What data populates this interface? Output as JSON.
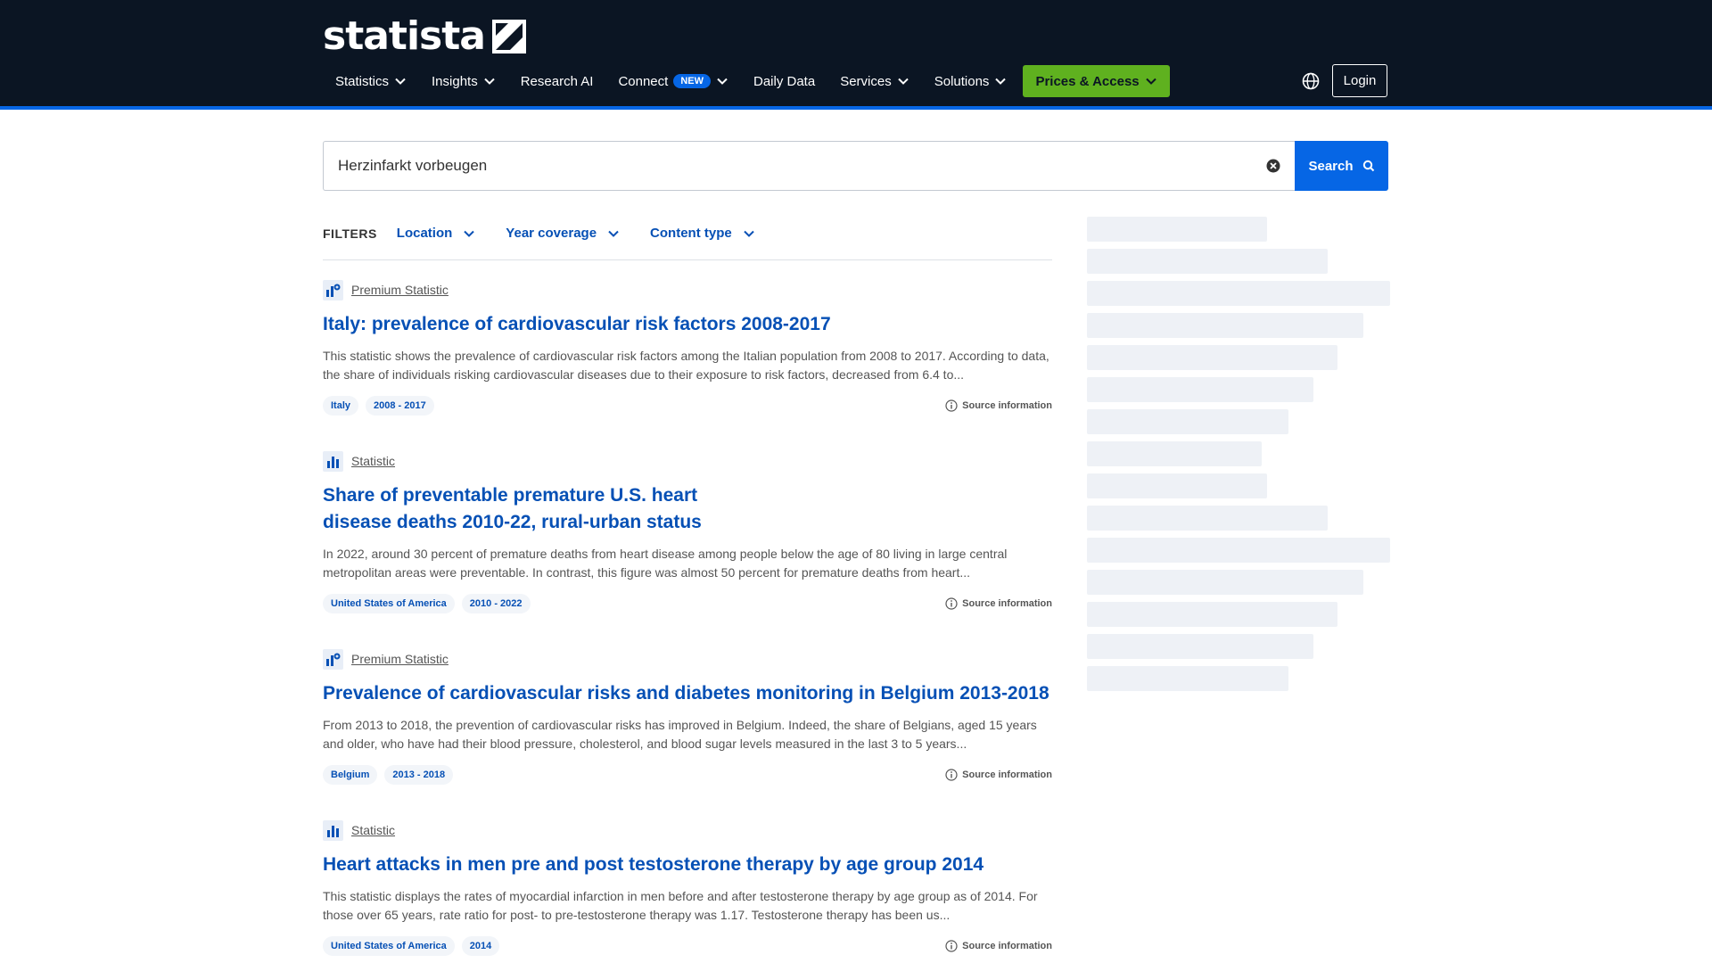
{
  "header": {
    "logo": "statista",
    "nav": [
      {
        "label": "Statistics",
        "chevron": true
      },
      {
        "label": "Insights",
        "chevron": true
      },
      {
        "label": "Research AI",
        "chevron": false
      },
      {
        "label": "Connect",
        "chevron": true,
        "badge": "NEW"
      },
      {
        "label": "Daily Data",
        "chevron": false
      },
      {
        "label": "Services",
        "chevron": true
      },
      {
        "label": "Solutions",
        "chevron": true
      }
    ],
    "prices_label": "Prices & Access",
    "login_label": "Login"
  },
  "search": {
    "value": "Herzinfarkt vorbeugen",
    "button_label": "Search"
  },
  "filters": {
    "label": "FILTERS",
    "items": [
      "Location",
      "Year coverage",
      "Content type"
    ]
  },
  "results": [
    {
      "type": "Premium Statistic",
      "premium": true,
      "title": "Italy: prevalence of cardiovascular risk factors 2008-2017",
      "desc": "This statistic shows the prevalence of cardiovascular risk factors among the Italian population from 2008 to 2017. According to data, the share of individuals risking cardiovascular diseases due to their exposure to risk factors, decreased from 6.4 to...",
      "tags": [
        "Italy",
        "2008 - 2017"
      ],
      "source": "Source information"
    },
    {
      "type": "Statistic",
      "premium": false,
      "title": "Share of preventable premature U.S. heart disease deaths 2010-22, rural-urban status",
      "desc": "In 2022, around 30 percent of premature deaths from heart disease among people below the age of 80 living in large central metropolitan areas were preventable. In contrast, this figure was almost 50 percent for premature deaths from heart...",
      "tags": [
        "United States of America",
        "2010 - 2022"
      ],
      "source": "Source information"
    },
    {
      "type": "Premium Statistic",
      "premium": true,
      "title": "Prevalence of cardiovascular risks and diabetes monitoring in Belgium 2013-2018",
      "desc": "From 2013 to 2018, the prevention of cardiovascular risks has improved in Belgium. Indeed, the share of Belgians, aged 15 years and older, who have had their blood pressure, cholesterol, and blood sugar levels measured in the last 3 to 5 years...",
      "tags": [
        "Belgium",
        "2013 - 2018"
      ],
      "source": "Source information"
    },
    {
      "type": "Statistic",
      "premium": false,
      "title": "Heart attacks in men pre and post testosterone therapy by age group 2014",
      "desc": "This statistic displays the rates of myocardial infarction in men before and after testosterone therapy by age group as of 2014. For those over 65 years, rate ratio for post- to pre-testosterone therapy was 1.17. Testosterone therapy has been us...",
      "tags": [
        "United States of America",
        "2014"
      ],
      "source": "Source information"
    }
  ],
  "colors": {
    "header_bg": "#0b1523",
    "accent_blue": "#0666e5",
    "link_blue": "#0650b5",
    "prices_green": "#5fb11f"
  }
}
